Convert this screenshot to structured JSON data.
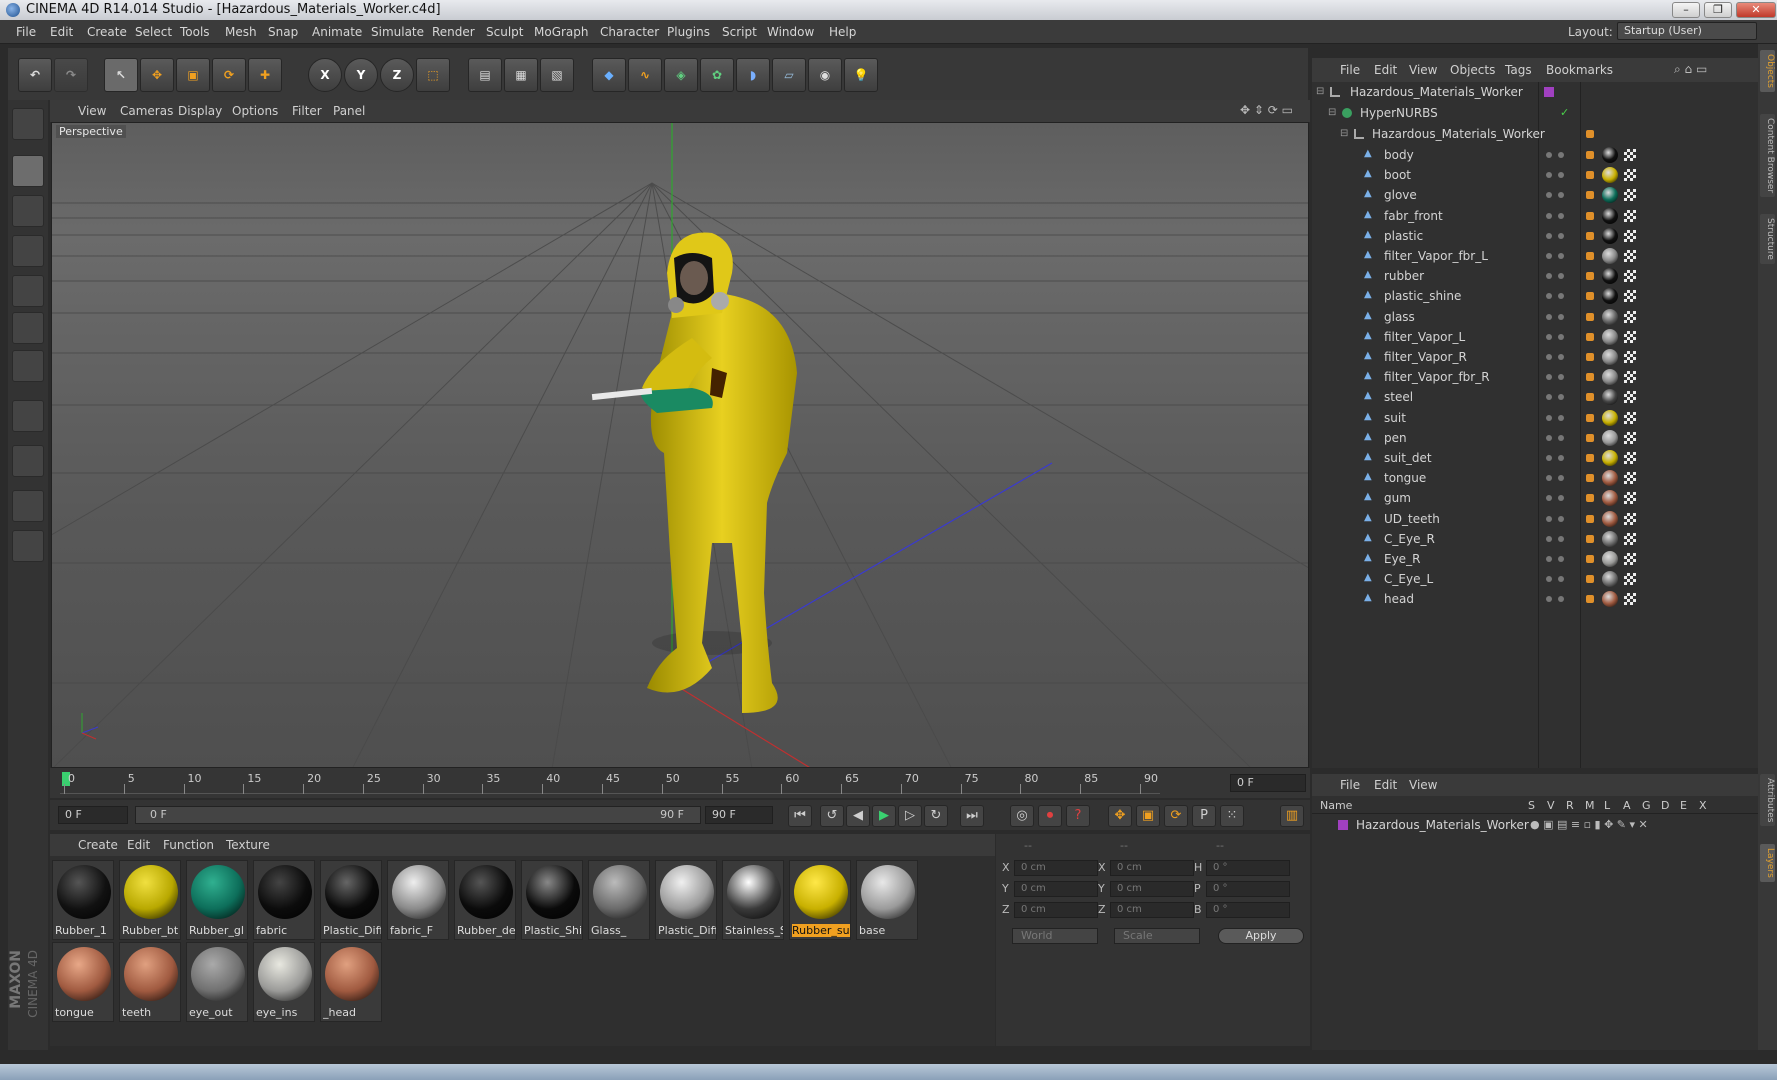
{
  "window": {
    "title": "CINEMA 4D R14.014 Studio - [Hazardous_Materials_Worker.c4d]"
  },
  "menubar": {
    "items": [
      "File",
      "Edit",
      "Create",
      "Select",
      "Tools",
      "Mesh",
      "Snap",
      "Animate",
      "Simulate",
      "Render",
      "Sculpt",
      "MoGraph",
      "Character",
      "Plugins",
      "Script",
      "Window",
      "Help"
    ],
    "layout_label": "Layout:",
    "layout_value": "Startup (User)"
  },
  "viewport": {
    "menu": [
      "View",
      "Cameras",
      "Display",
      "Options",
      "Filter",
      "Panel"
    ],
    "label": "Perspective"
  },
  "timeline": {
    "ticks": [
      "0",
      "5",
      "10",
      "15",
      "20",
      "25",
      "30",
      "35",
      "40",
      "45",
      "50",
      "55",
      "60",
      "65",
      "70",
      "75",
      "80",
      "85",
      "90"
    ],
    "current_frame": "0 F",
    "start_field": "0 F",
    "range_start": "0 F",
    "range_end": "90 F",
    "end_field": "90 F"
  },
  "material_manager": {
    "menu": [
      "Create",
      "Edit",
      "Function",
      "Texture"
    ],
    "materials": [
      {
        "label": "Rubber_1",
        "color": "#111111",
        "hi": "#555555",
        "selected": false
      },
      {
        "label": "Rubber_bt",
        "color": "#b8a800",
        "hi": "#f0e040",
        "selected": false
      },
      {
        "label": "Rubber_gl",
        "color": "#0d6e5a",
        "hi": "#30b090",
        "selected": false
      },
      {
        "label": "fabric",
        "color": "#0c0c0c",
        "hi": "#444444",
        "selected": false
      },
      {
        "label": "Plastic_Diff",
        "color": "#0a0a0a",
        "hi": "#666666",
        "selected": false
      },
      {
        "label": "fabric_F",
        "color": "#8a8a8a",
        "hi": "#eeeeee",
        "selected": false
      },
      {
        "label": "Rubber_de",
        "color": "#0b0b0b",
        "hi": "#555555",
        "selected": false
      },
      {
        "label": "Plastic_Shir",
        "color": "#0a0a0a",
        "hi": "#888888",
        "selected": false
      },
      {
        "label": "Glass_",
        "color": "#6a6a6a",
        "hi": "#bbbbbb",
        "selected": false
      },
      {
        "label": "Plastic_Diff",
        "color": "#9a9a9a",
        "hi": "#f0f0f0",
        "selected": false
      },
      {
        "label": "Stainless_S",
        "color": "#3a3a3a",
        "hi": "#ffffff",
        "selected": false
      },
      {
        "label": "Rubber_su",
        "color": "#c8b000",
        "hi": "#ffe848",
        "selected": true
      },
      {
        "label": "base",
        "color": "#9a9a9a",
        "hi": "#e8e8e8",
        "selected": false
      },
      {
        "label": "tongue",
        "color": "#a05a40",
        "hi": "#e8a888",
        "selected": false
      },
      {
        "label": "teeth",
        "color": "#a05a40",
        "hi": "#e0a080",
        "selected": false
      },
      {
        "label": "eye_out",
        "color": "#707070",
        "hi": "#aaaaaa",
        "selected": false
      },
      {
        "label": "eye_ins",
        "color": "#9a9a98",
        "hi": "#e8e8e0",
        "selected": false
      },
      {
        "label": "_head",
        "color": "#a05a40",
        "hi": "#e0a080",
        "selected": false
      }
    ]
  },
  "coordinates": {
    "headers": [
      "--",
      "--",
      "--"
    ],
    "rows": [
      {
        "a": "X",
        "av": "0 cm",
        "b": "X",
        "bv": "0 cm",
        "c": "H",
        "cv": "0 °"
      },
      {
        "a": "Y",
        "av": "0 cm",
        "b": "Y",
        "bv": "0 cm",
        "c": "P",
        "cv": "0 °"
      },
      {
        "a": "Z",
        "av": "0 cm",
        "b": "Z",
        "bv": "0 cm",
        "c": "B",
        "cv": "0 °"
      }
    ],
    "mode": "World",
    "scale": "Scale",
    "apply": "Apply"
  },
  "object_manager": {
    "menu": [
      "File",
      "Edit",
      "View",
      "Objects",
      "Tags",
      "Bookmarks"
    ],
    "root": "Hazardous_Materials_Worker",
    "hypernurbs": "HyperNURBS",
    "group": "Hazardous_Materials_Worker",
    "children": [
      {
        "name": "body",
        "mat": "#111111"
      },
      {
        "name": "boot",
        "mat": "#c8b000"
      },
      {
        "name": "glove",
        "mat": "#0d6e5a"
      },
      {
        "name": "fabr_front",
        "mat": "#111111"
      },
      {
        "name": "plastic",
        "mat": "#111111"
      },
      {
        "name": "filter_Vapor_fbr_L",
        "mat": "#8a8a8a"
      },
      {
        "name": "rubber",
        "mat": "#111111"
      },
      {
        "name": "plastic_shine",
        "mat": "#111111"
      },
      {
        "name": "glass",
        "mat": "#666666"
      },
      {
        "name": "filter_Vapor_L",
        "mat": "#8a8a8a"
      },
      {
        "name": "filter_Vapor_R",
        "mat": "#8a8a8a"
      },
      {
        "name": "filter_Vapor_fbr_R",
        "mat": "#8a8a8a"
      },
      {
        "name": "steel",
        "mat": "#444444"
      },
      {
        "name": "suit",
        "mat": "#c8b000"
      },
      {
        "name": "pen",
        "mat": "#9a9a9a"
      },
      {
        "name": "suit_det",
        "mat": "#c8b000"
      },
      {
        "name": "tongue",
        "mat": "#a05a40"
      },
      {
        "name": "gum",
        "mat": "#a05a40"
      },
      {
        "name": "UD_teeth",
        "mat": "#a05a40"
      },
      {
        "name": "C_Eye_R",
        "mat": "#707070"
      },
      {
        "name": "Eye_R",
        "mat": "#9a9a98"
      },
      {
        "name": "C_Eye_L",
        "mat": "#707070"
      },
      {
        "name": "head",
        "mat": "#a05a40"
      }
    ]
  },
  "layer_manager": {
    "menu": [
      "File",
      "Edit",
      "View"
    ],
    "columns": [
      "Name",
      "S",
      "V",
      "R",
      "M",
      "L",
      "A",
      "G",
      "D",
      "E",
      "X"
    ],
    "layer": "Hazardous_Materials_Worker",
    "layer_color": "#a040c0"
  },
  "right_tabs": [
    "Objects",
    "Content Browser",
    "Structure",
    "Attributes",
    "Layers"
  ],
  "logo": {
    "line1": "MAXON",
    "line2": "CINEMA 4D"
  },
  "colors": {
    "accent": "#f0a020",
    "selected_layer": "#a040c0"
  }
}
